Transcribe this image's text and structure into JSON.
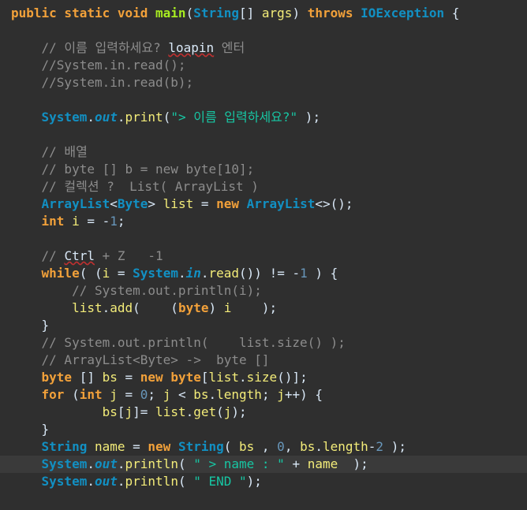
{
  "lines": [
    [
      [
        "kw",
        "public static void "
      ],
      [
        "fn",
        "main"
      ],
      [
        "op",
        "("
      ],
      [
        "ty",
        "String"
      ],
      [
        "op",
        "[] "
      ],
      [
        "var",
        "args"
      ],
      [
        "op",
        ") "
      ],
      [
        "kw",
        "throws "
      ],
      [
        "ty",
        "IOException"
      ],
      [
        "op",
        " {"
      ]
    ],
    [],
    [
      [
        "cm",
        "    // 이름 입력하세요? "
      ],
      [
        "sp",
        "loapin"
      ],
      [
        "cm",
        " 엔터"
      ]
    ],
    [
      [
        "cm",
        "    //System.in.read();"
      ]
    ],
    [
      [
        "cm",
        "    //System.in.read(b);"
      ]
    ],
    [],
    [
      [
        "op",
        "    "
      ],
      [
        "ty",
        "System"
      ],
      [
        "op",
        "."
      ],
      [
        "io",
        "out"
      ],
      [
        "op",
        "."
      ],
      [
        "var",
        "print"
      ],
      [
        "op",
        "("
      ],
      [
        "str",
        "\"> 이름 입력하세요?\""
      ],
      [
        "op",
        " );"
      ]
    ],
    [],
    [
      [
        "cm",
        "    // 배열"
      ]
    ],
    [
      [
        "cm",
        "    // byte [] b = new byte[10];"
      ]
    ],
    [
      [
        "cm",
        "    // 컬렉션 ?  List( ArrayList )"
      ]
    ],
    [
      [
        "op",
        "    "
      ],
      [
        "ty",
        "ArrayList"
      ],
      [
        "op",
        "<"
      ],
      [
        "ty",
        "Byte"
      ],
      [
        "op",
        "> "
      ],
      [
        "var",
        "list"
      ],
      [
        "op",
        " = "
      ],
      [
        "kw",
        "new "
      ],
      [
        "ty",
        "ArrayList"
      ],
      [
        "op",
        "<>();"
      ]
    ],
    [
      [
        "op",
        "    "
      ],
      [
        "kw",
        "int "
      ],
      [
        "var",
        "i"
      ],
      [
        "op",
        " = -"
      ],
      [
        "num",
        "1"
      ],
      [
        "op",
        ";"
      ]
    ],
    [],
    [
      [
        "cm",
        "    // "
      ],
      [
        "sp",
        "Ctrl"
      ],
      [
        "cm",
        " + Z   -1"
      ]
    ],
    [
      [
        "op",
        "    "
      ],
      [
        "kw",
        "while"
      ],
      [
        "op",
        "( ("
      ],
      [
        "var",
        "i"
      ],
      [
        "op",
        " = "
      ],
      [
        "ty",
        "System"
      ],
      [
        "op",
        "."
      ],
      [
        "io",
        "in"
      ],
      [
        "op",
        "."
      ],
      [
        "var",
        "read"
      ],
      [
        "op",
        "()) != -"
      ],
      [
        "num",
        "1"
      ],
      [
        "op",
        " ) {"
      ]
    ],
    [
      [
        "cm",
        "        // System.out.println(i);"
      ]
    ],
    [
      [
        "op",
        "        "
      ],
      [
        "var",
        "list"
      ],
      [
        "op",
        "."
      ],
      [
        "var",
        "add"
      ],
      [
        "op",
        "(    ("
      ],
      [
        "kw",
        "byte"
      ],
      [
        "op",
        ") "
      ],
      [
        "var",
        "i"
      ],
      [
        "op",
        "    );"
      ]
    ],
    [
      [
        "op",
        "    }"
      ]
    ],
    [
      [
        "cm",
        "    // System.out.println(    list.size() );"
      ]
    ],
    [
      [
        "cm",
        "    // ArrayList<Byte> ->  byte []"
      ]
    ],
    [
      [
        "op",
        "    "
      ],
      [
        "kw",
        "byte "
      ],
      [
        "op",
        "[] "
      ],
      [
        "var",
        "bs"
      ],
      [
        "op",
        " = "
      ],
      [
        "kw",
        "new byte"
      ],
      [
        "op",
        "["
      ],
      [
        "var",
        "list"
      ],
      [
        "op",
        "."
      ],
      [
        "var",
        "size"
      ],
      [
        "op",
        "()];"
      ]
    ],
    [
      [
        "op",
        "    "
      ],
      [
        "kw",
        "for "
      ],
      [
        "op",
        "("
      ],
      [
        "kw",
        "int "
      ],
      [
        "var",
        "j"
      ],
      [
        "op",
        " = "
      ],
      [
        "num",
        "0"
      ],
      [
        "op",
        "; "
      ],
      [
        "var",
        "j"
      ],
      [
        "op",
        " < "
      ],
      [
        "var",
        "bs"
      ],
      [
        "op",
        "."
      ],
      [
        "var",
        "length"
      ],
      [
        "op",
        "; "
      ],
      [
        "var",
        "j"
      ],
      [
        "op",
        "++) {"
      ]
    ],
    [
      [
        "op",
        "            "
      ],
      [
        "var",
        "bs"
      ],
      [
        "op",
        "["
      ],
      [
        "var",
        "j"
      ],
      [
        "op",
        "]= "
      ],
      [
        "var",
        "list"
      ],
      [
        "op",
        "."
      ],
      [
        "var",
        "get"
      ],
      [
        "op",
        "("
      ],
      [
        "var",
        "j"
      ],
      [
        "op",
        ");"
      ]
    ],
    [
      [
        "op",
        "    }"
      ]
    ],
    [
      [
        "op",
        "    "
      ],
      [
        "ty",
        "String "
      ],
      [
        "var",
        "name"
      ],
      [
        "op",
        " = "
      ],
      [
        "kw",
        "new "
      ],
      [
        "ty",
        "String"
      ],
      [
        "op",
        "( "
      ],
      [
        "var",
        "bs"
      ],
      [
        "op",
        " , "
      ],
      [
        "num",
        "0"
      ],
      [
        "op",
        ", "
      ],
      [
        "var",
        "bs"
      ],
      [
        "op",
        "."
      ],
      [
        "var",
        "length"
      ],
      [
        "op",
        "-"
      ],
      [
        "num",
        "2"
      ],
      [
        "op",
        " );"
      ]
    ],
    [
      [
        "op",
        "    "
      ],
      [
        "ty",
        "System"
      ],
      [
        "op",
        "."
      ],
      [
        "io",
        "out"
      ],
      [
        "op",
        "."
      ],
      [
        "var",
        "println"
      ],
      [
        "op",
        "( "
      ],
      [
        "str",
        "\" > name : \""
      ],
      [
        "op",
        " + "
      ],
      [
        "var",
        "name"
      ],
      [
        "op",
        "  );"
      ]
    ],
    [
      [
        "op",
        "    "
      ],
      [
        "ty",
        "System"
      ],
      [
        "op",
        "."
      ],
      [
        "io",
        "out"
      ],
      [
        "op",
        "."
      ],
      [
        "var",
        "println"
      ],
      [
        "op",
        "( "
      ],
      [
        "str",
        "\" END \""
      ],
      [
        "op",
        ");"
      ]
    ]
  ],
  "current_line": 27
}
